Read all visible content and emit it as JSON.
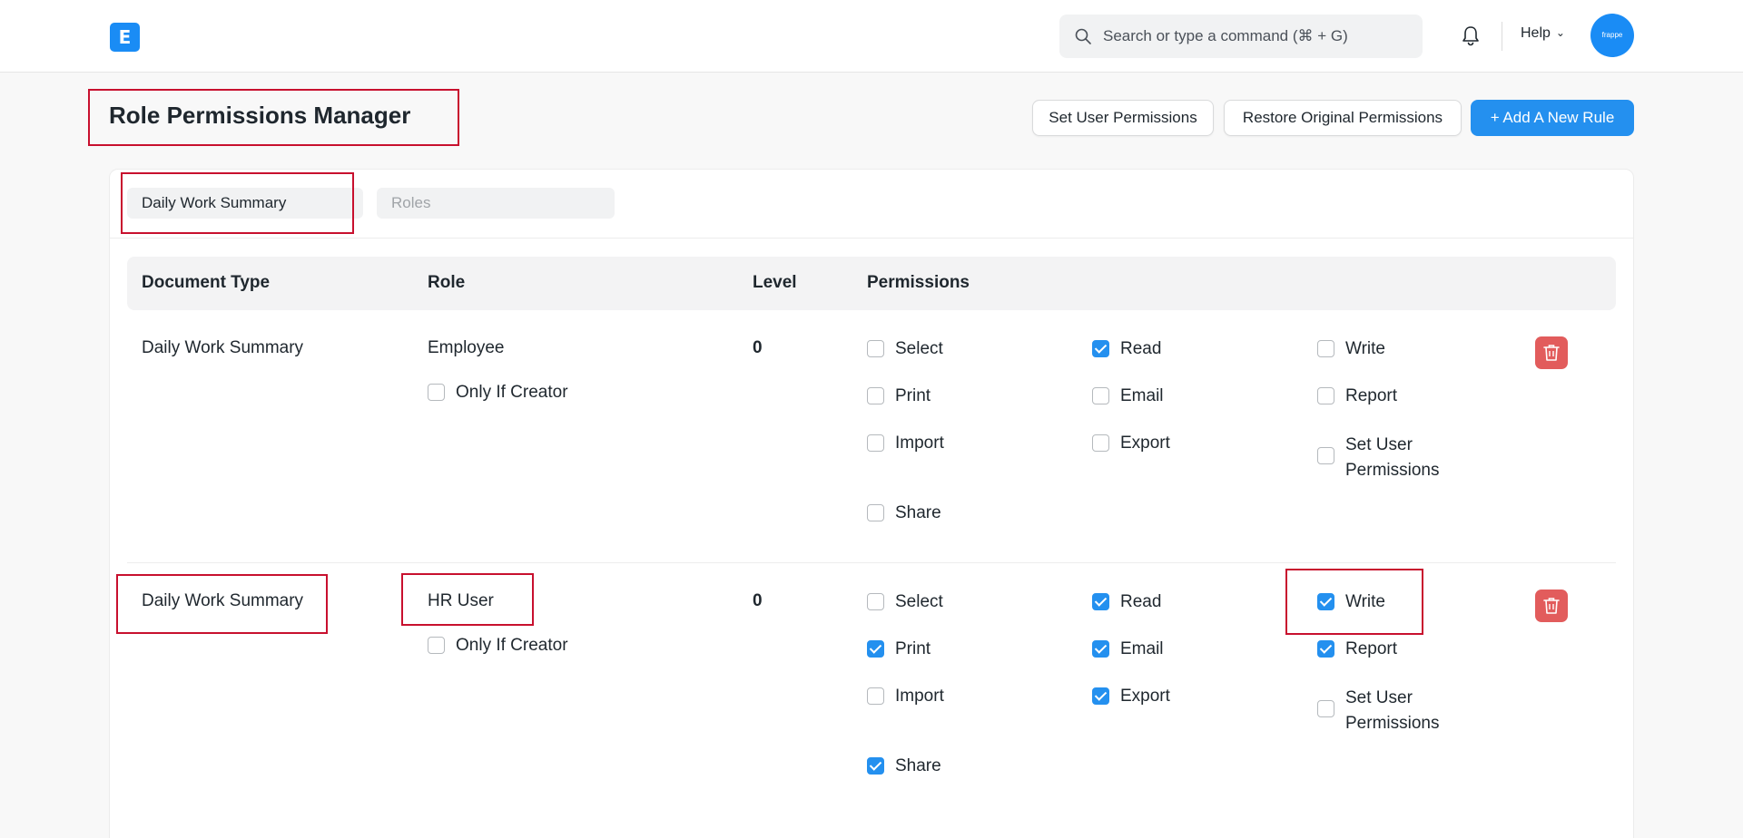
{
  "navbar": {
    "logo_letter": "E",
    "search_placeholder": "Search or type a command (⌘ + G)",
    "help_label": "Help",
    "avatar_text": "frappe"
  },
  "page": {
    "title": "Role Permissions Manager",
    "buttons": {
      "set_user_permissions": "Set User Permissions",
      "restore": "Restore Original Permissions",
      "add_rule": "+ Add A New Rule"
    }
  },
  "filters": {
    "doctype_value": "Daily Work Summary",
    "roles_placeholder": "Roles"
  },
  "table": {
    "headers": {
      "doctype": "Document Type",
      "role": "Role",
      "level": "Level",
      "permissions": "Permissions"
    },
    "rows": [
      {
        "doctype": "Daily Work Summary",
        "role": "Employee",
        "only_if_creator_label": "Only If Creator",
        "only_if_creator": false,
        "level": "0",
        "perms": {
          "select": {
            "label": "Select",
            "checked": false
          },
          "read": {
            "label": "Read",
            "checked": true
          },
          "write": {
            "label": "Write",
            "checked": false
          },
          "print": {
            "label": "Print",
            "checked": false
          },
          "email": {
            "label": "Email",
            "checked": false
          },
          "report": {
            "label": "Report",
            "checked": false
          },
          "import": {
            "label": "Import",
            "checked": false
          },
          "export": {
            "label": "Export",
            "checked": false
          },
          "set_user_permissions": {
            "label_line1": "Set User",
            "label_line2": "Permissions",
            "checked": false
          },
          "share": {
            "label": "Share",
            "checked": false
          }
        }
      },
      {
        "doctype": "Daily Work Summary",
        "role": "HR User",
        "only_if_creator_label": "Only If Creator",
        "only_if_creator": false,
        "level": "0",
        "perms": {
          "select": {
            "label": "Select",
            "checked": false
          },
          "read": {
            "label": "Read",
            "checked": true
          },
          "write": {
            "label": "Write",
            "checked": true
          },
          "print": {
            "label": "Print",
            "checked": true
          },
          "email": {
            "label": "Email",
            "checked": true
          },
          "report": {
            "label": "Report",
            "checked": true
          },
          "import": {
            "label": "Import",
            "checked": false
          },
          "export": {
            "label": "Export",
            "checked": true
          },
          "set_user_permissions": {
            "label_line1": "Set User",
            "label_line2": "Permissions",
            "checked": false
          },
          "share": {
            "label": "Share",
            "checked": true
          }
        }
      }
    ]
  },
  "colors": {
    "primary": "#2490ef",
    "danger": "#e25c5c",
    "highlight": "#c8102e"
  }
}
